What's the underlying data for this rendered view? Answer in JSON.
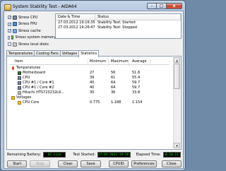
{
  "window": {
    "title": "System Stability Test - AIDA64",
    "minimize_label": "–",
    "maximize_label": "□",
    "close_label": "x"
  },
  "stress_options": [
    {
      "label": "Stress CPU",
      "checked": true,
      "icon": "cpu-icon"
    },
    {
      "label": "Stress FPU",
      "checked": true,
      "icon": "fpu-icon"
    },
    {
      "label": "Stress cache",
      "checked": true,
      "icon": "cache-icon"
    },
    {
      "label": "Stress system memory",
      "checked": false,
      "icon": "memory-icon"
    },
    {
      "label": "Stress local disks",
      "checked": false,
      "icon": "disk-icon"
    }
  ],
  "log": {
    "headers": {
      "datetime": "Date & Time",
      "status": "Status"
    },
    "rows": [
      {
        "datetime": "27.03.2012 19:16:35",
        "status": "Stability Test: Started"
      },
      {
        "datetime": "27.03.2012 19:26:47",
        "status": "Stability Test: Stopped"
      }
    ]
  },
  "tabs": [
    "Temperatures",
    "Cooling Fans",
    "Voltages",
    "Statistics"
  ],
  "active_tab": "Statistics",
  "stats": {
    "headers": {
      "item": "Item",
      "min": "Minimum",
      "max": "Maximum",
      "avg": "Average"
    },
    "rows": [
      {
        "item": "Temperatures",
        "min": "",
        "max": "",
        "avg": "",
        "level": 1,
        "icon": "thermometer-icon"
      },
      {
        "item": "Motherboard",
        "min": "27",
        "max": "56",
        "avg": "51.6",
        "level": 2,
        "icon": "motherboard-icon"
      },
      {
        "item": "CPU",
        "min": "39",
        "max": "61",
        "avg": "55.4",
        "level": 2,
        "icon": "cpu-chip-icon"
      },
      {
        "item": "CPU #1 / Core #1",
        "min": "40",
        "max": "64",
        "avg": "59.7",
        "level": 2,
        "icon": "cpu-chip-icon"
      },
      {
        "item": "CPU #1 / Core #2",
        "min": "40",
        "max": "64",
        "avg": "59.7",
        "level": 2,
        "icon": "cpu-chip-icon"
      },
      {
        "item": "Hitachi HTS723232L9...",
        "min": "30",
        "max": "36",
        "avg": "33.8",
        "level": 2,
        "icon": "hard-disk-icon"
      },
      {
        "item": "Voltages",
        "min": "",
        "max": "",
        "avg": "",
        "level": 1,
        "icon": "voltage-icon"
      },
      {
        "item": "CPU Core",
        "min": "0.775",
        "max": "1.188",
        "avg": "1.154",
        "level": 2,
        "icon": "voltage-icon"
      }
    ]
  },
  "status": {
    "battery_label": "Remaining Battery:",
    "battery_value": "AC Line",
    "started_label": "Test Started:",
    "started_value": "27.03.2012 19:16:35",
    "elapsed_label": "Elapsed Time:",
    "elapsed_value": "0:10:11"
  },
  "buttons": {
    "start": "Start",
    "stop": "Stop",
    "clear": "Clear",
    "save": "Save",
    "cpuid": "CPUID",
    "preferences": "Preferences",
    "close": "Close"
  },
  "colors": {
    "lcd_background": "#000000",
    "lcd_text": "#00e400",
    "close_button": "#c7402b"
  }
}
